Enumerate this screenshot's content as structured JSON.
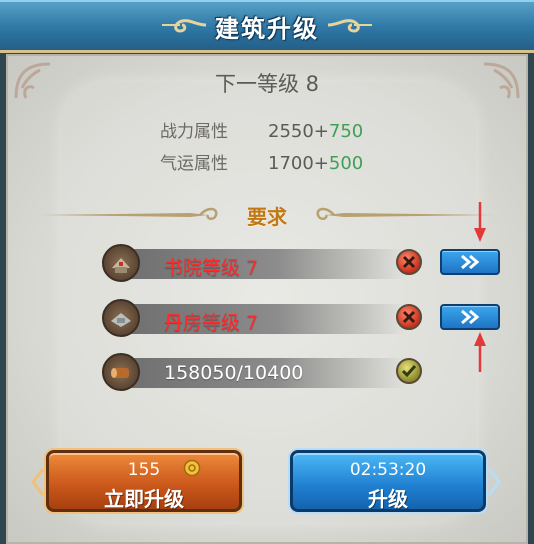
{
  "header": {
    "title": "建筑升级"
  },
  "next_level": {
    "text": "下一等级 8"
  },
  "stats": [
    {
      "label": "战力属性",
      "base": "2550+",
      "bonus": "750"
    },
    {
      "label": "气运属性",
      "base": "1700+",
      "bonus": "500"
    }
  ],
  "requirements": {
    "title": "要求",
    "items": [
      {
        "text": "书院等级  7",
        "met": false,
        "icon": "academy-building-icon"
      },
      {
        "text": "丹房等级  7",
        "met": false,
        "icon": "alchemy-house-icon"
      },
      {
        "text": "158050/10400",
        "met": true,
        "icon": "wood-log-icon"
      }
    ]
  },
  "buttons": {
    "instant": {
      "cost": "155",
      "label": "立即升级"
    },
    "upgrade": {
      "time": "02:53:20",
      "label": "升级"
    }
  },
  "colors": {
    "requirement_unmet": "#ff2a2a",
    "bonus": "#3fa055",
    "header_blue": "#2f78a6",
    "instant_button": "#c9561a",
    "upgrade_button": "#1f7fd0",
    "annotation_arrow": "#e23a3a"
  }
}
